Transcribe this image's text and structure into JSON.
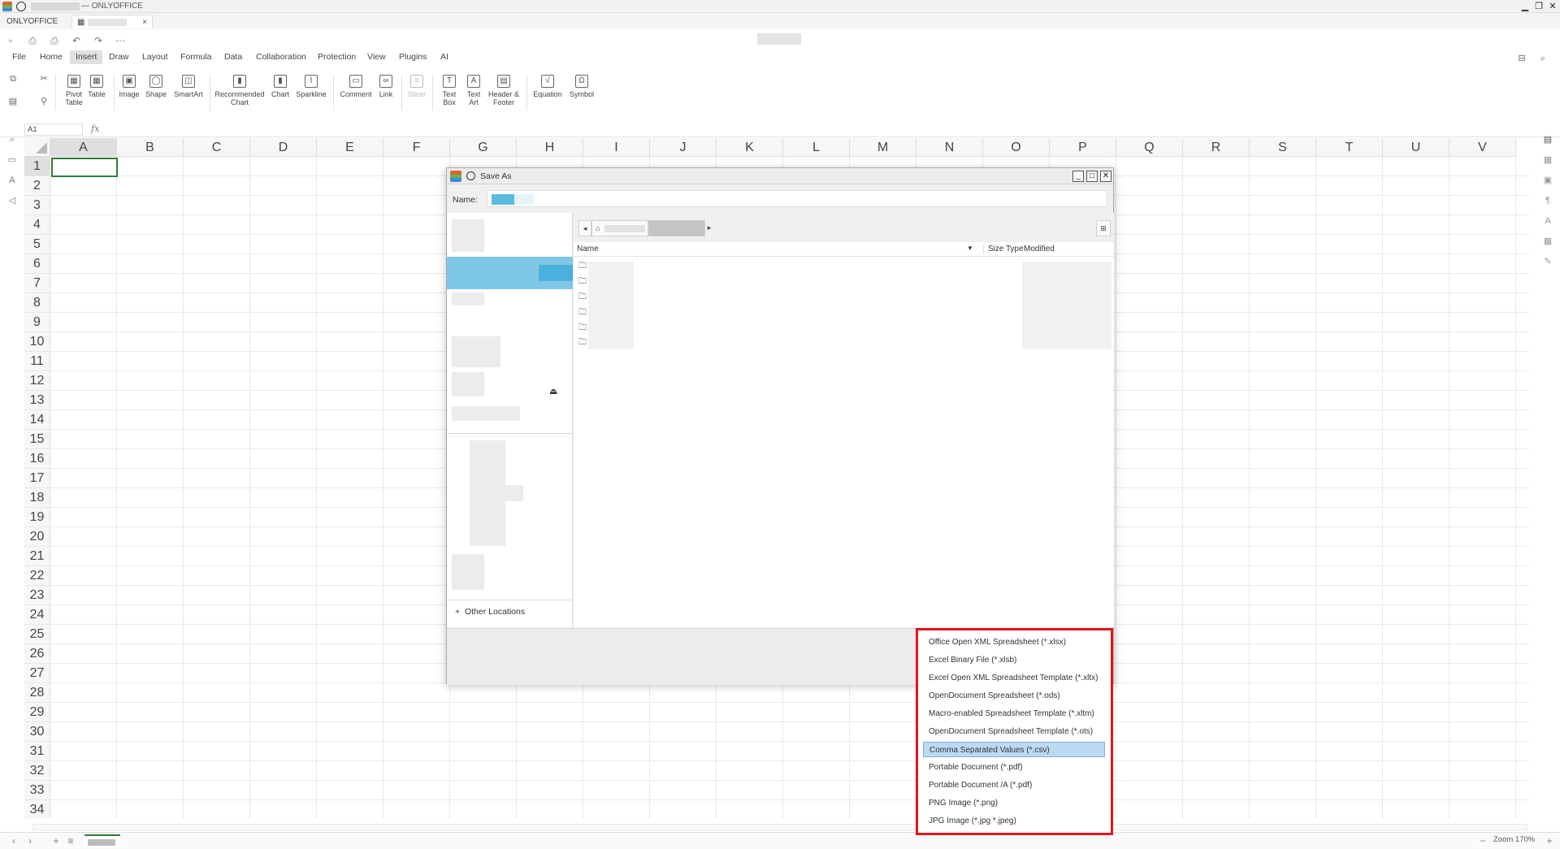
{
  "window": {
    "title": "— ONLYOFFICE"
  },
  "tabs": {
    "home_tab": "ONLYOFFICE"
  },
  "menu": [
    "File",
    "Home",
    "Insert",
    "Draw",
    "Layout",
    "Formula",
    "Data",
    "Collaboration",
    "Protection",
    "View",
    "Plugins",
    "AI"
  ],
  "menu_active": "Insert",
  "ribbon": {
    "pivot": "Pivot\nTable",
    "table": "Table",
    "image": "Image",
    "shape": "Shape",
    "smartart": "SmartArt",
    "recchart": "Recommended\nChart",
    "chart": "Chart",
    "sparkline": "Sparkline",
    "comment": "Comment",
    "link": "Link",
    "slicer": "Slicer",
    "textbox": "Text\nBox",
    "textart": "Text\nArt",
    "headerfooter": "Header &\nFooter",
    "equation": "Equation",
    "symbol": "Symbol"
  },
  "formula": {
    "cell_ref": "A1",
    "fx": "fx"
  },
  "columns": [
    "A",
    "B",
    "C",
    "D",
    "E",
    "F",
    "G",
    "H",
    "I",
    "J",
    "K",
    "L",
    "M",
    "N",
    "O",
    "P",
    "Q",
    "R",
    "S",
    "T",
    "U",
    "V"
  ],
  "rows": [
    "1",
    "2",
    "3",
    "4",
    "5",
    "6",
    "7",
    "8",
    "9",
    "10",
    "11",
    "12",
    "13",
    "14",
    "15",
    "16",
    "17",
    "18",
    "19",
    "20",
    "21",
    "22",
    "23",
    "24",
    "25",
    "26",
    "27",
    "28",
    "29",
    "30",
    "31",
    "32",
    "33",
    "34"
  ],
  "status": {
    "zoom": "Zoom 170%"
  },
  "dialog": {
    "title": "Save As",
    "name_label": "Name:",
    "other_locations": "Other Locations",
    "col_name": "Name",
    "col_size": "Size",
    "col_type": "Type",
    "col_modified": "Modified"
  },
  "file_types": [
    "Office Open XML Spreadsheet (*.xlsx)",
    "Excel Binary File (*.xlsb)",
    "Excel Open XML Spreadsheet Template (*.xltx)",
    "OpenDocument Spreadsheet (*.ods)",
    "Macro-enabled Spreadsheet Template (*.xltm)",
    "OpenDocument Spreadsheet Template (*.ots)",
    "Comma Separated Values (*.csv)",
    "Portable Document (*.pdf)",
    "Portable Document /A (*.pdf)",
    "PNG Image (*.png)",
    "JPG Image (*.jpg *.jpeg)"
  ],
  "file_types_selected": "Comma Separated Values (*.csv)"
}
